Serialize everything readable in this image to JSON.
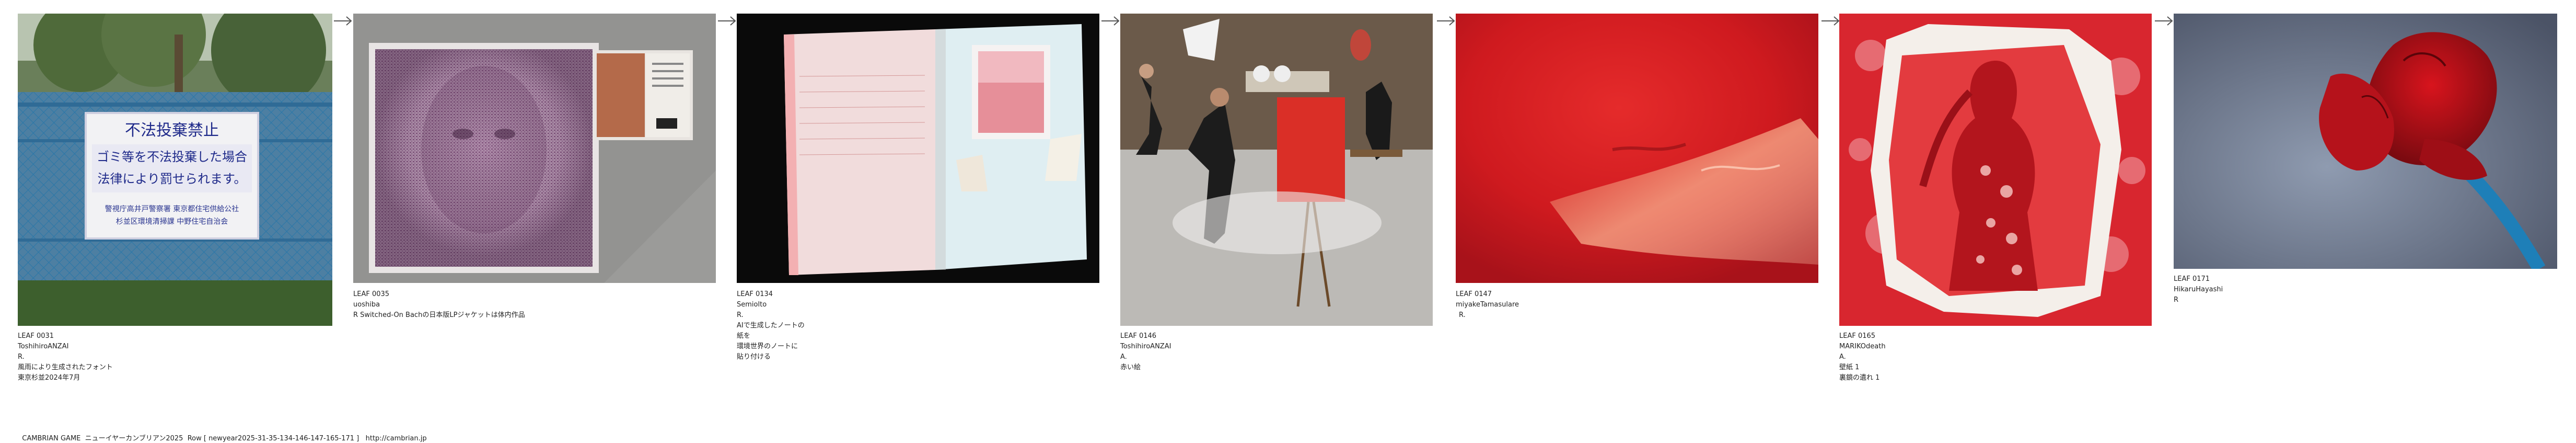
{
  "leaves": [
    {
      "id": "LEAF 0031",
      "author": "ToshihiroANZAI",
      "lines": [
        "R.",
        "風雨により生成されたフォント",
        "東京杉並2024年7月"
      ],
      "sign": {
        "l1": "不法投棄禁止",
        "l2": "ゴミ等を不法投棄した場合",
        "l3": "法律により罰せられます。",
        "l4": "警視庁高井戸警察署 東京都住宅供給公社",
        "l5": "杉並区環境清掃課 中野住宅自治会"
      }
    },
    {
      "id": "LEAF 0035",
      "author": "uoshiba",
      "lines": [
        "R Switched-On Bachの日本版LPジャケットは体内作品"
      ]
    },
    {
      "id": "LEAF 0134",
      "author": "Semiolto",
      "lines": [
        "R.",
        "AIで生成したノートの",
        "紙を",
        "環境世界のノートに",
        "貼り付ける"
      ]
    },
    {
      "id": "LEAF 0146",
      "author": "ToshihiroANZAI",
      "lines": [
        "A.",
        "赤い絵"
      ]
    },
    {
      "id": "LEAF 0147",
      "author": "miyakeTamasulare",
      "lines": [
        "R."
      ]
    },
    {
      "id": "LEAF 0165",
      "author": "MARIKOdeath",
      "lines": [
        "A.",
        "壁紙 1",
        "裏鏡の遺れ 1"
      ]
    },
    {
      "id": "LEAF 0171",
      "author": "HikaruHayashi",
      "lines": [
        "R"
      ]
    }
  ],
  "footer": {
    "text": "CAMBRIAN GAME  ニューイヤーカンブリアン2025  Row [ newyear2025-31-35-134-146-147-165-171 ]   ",
    "link": "http://cambrian.jp"
  },
  "colors": {
    "background": "#ffffff",
    "text": "#222222",
    "arrow": "#555555",
    "accent_red": "#d3161f"
  }
}
